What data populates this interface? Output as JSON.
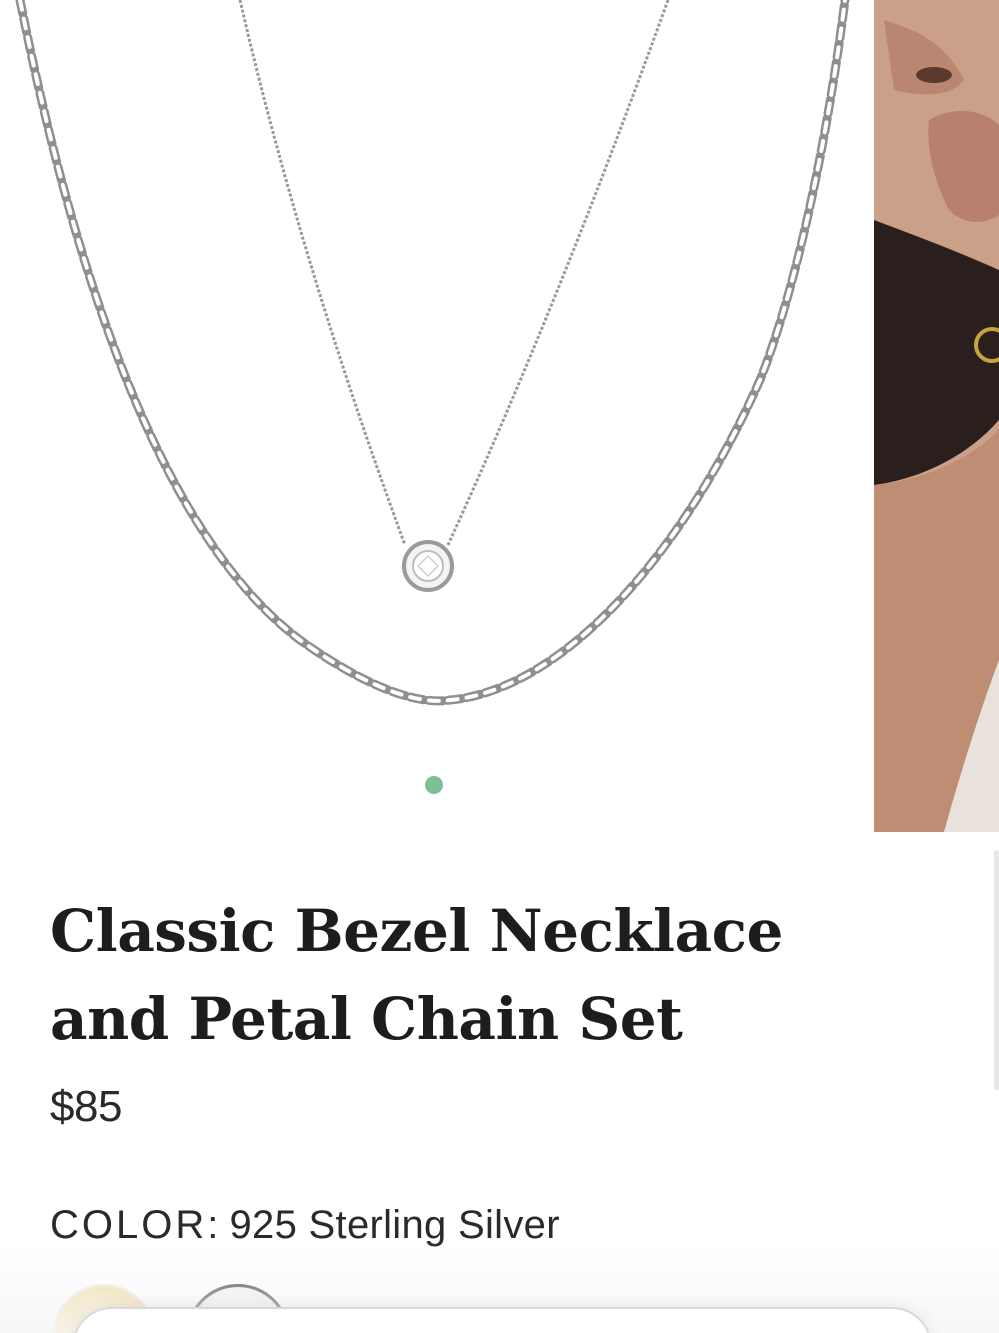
{
  "product": {
    "title": "Classic Bezel Necklace and Petal Chain Set",
    "price": "$85"
  },
  "color_selector": {
    "label": "COLOR",
    "separator": ":",
    "selected_value": "925 Sterling Silver",
    "swatches": [
      {
        "name": "gold",
        "color": "#f4dca0",
        "selected": false
      },
      {
        "name": "silver",
        "color": "#eeeeee",
        "selected": true
      }
    ]
  },
  "carousel": {
    "slide_count_visible_dots": 1,
    "active_dot_color": "#7fbf98",
    "slides": [
      {
        "alt": "necklace product photo",
        "icon": "necklace-image"
      },
      {
        "alt": "model wearing necklace",
        "icon": "model-image"
      }
    ]
  }
}
